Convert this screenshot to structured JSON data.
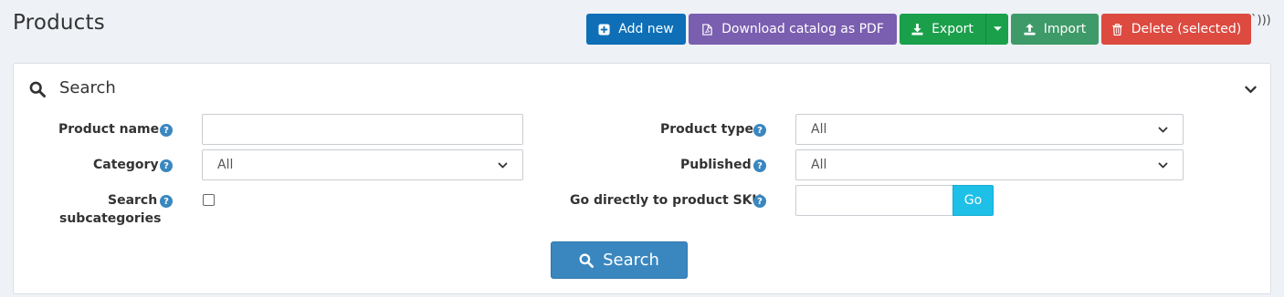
{
  "header": {
    "title": "Products",
    "stray_text": "`)))"
  },
  "toolbar": {
    "add_new": "Add new",
    "download_pdf": "Download catalog as PDF",
    "export": "Export",
    "import": "Import",
    "delete_selected": "Delete (selected)"
  },
  "search_panel": {
    "title": "Search",
    "fields": {
      "product_name": {
        "label": "Product name",
        "value": ""
      },
      "category": {
        "label": "Category",
        "value": "All"
      },
      "search_subcategories": {
        "label_line1": "Search",
        "label_line2": "subcategories",
        "checked": false
      },
      "product_type": {
        "label": "Product type",
        "value": "All"
      },
      "published": {
        "label": "Published",
        "value": "All"
      },
      "sku": {
        "label": "Go directly to product SKU",
        "value": "",
        "go_label": "Go"
      }
    },
    "help_glyph": "?",
    "search_button": "Search"
  },
  "colors": {
    "add_new": "#0e6fb7",
    "download_pdf": "#7a5eb0",
    "export": "#1aa04b",
    "import": "#3e9a68",
    "delete": "#dc4a40",
    "go": "#1ec0e8",
    "search": "#3a87c0"
  },
  "icons": {
    "add_new": "plus-square-icon",
    "download_pdf": "file-pdf-icon",
    "export": "download-icon",
    "export_menu": "caret-down-icon",
    "import": "upload-icon",
    "delete": "trash-icon",
    "panel": "search-icon",
    "collapse": "chevron-down-icon",
    "search_button": "search-icon"
  }
}
